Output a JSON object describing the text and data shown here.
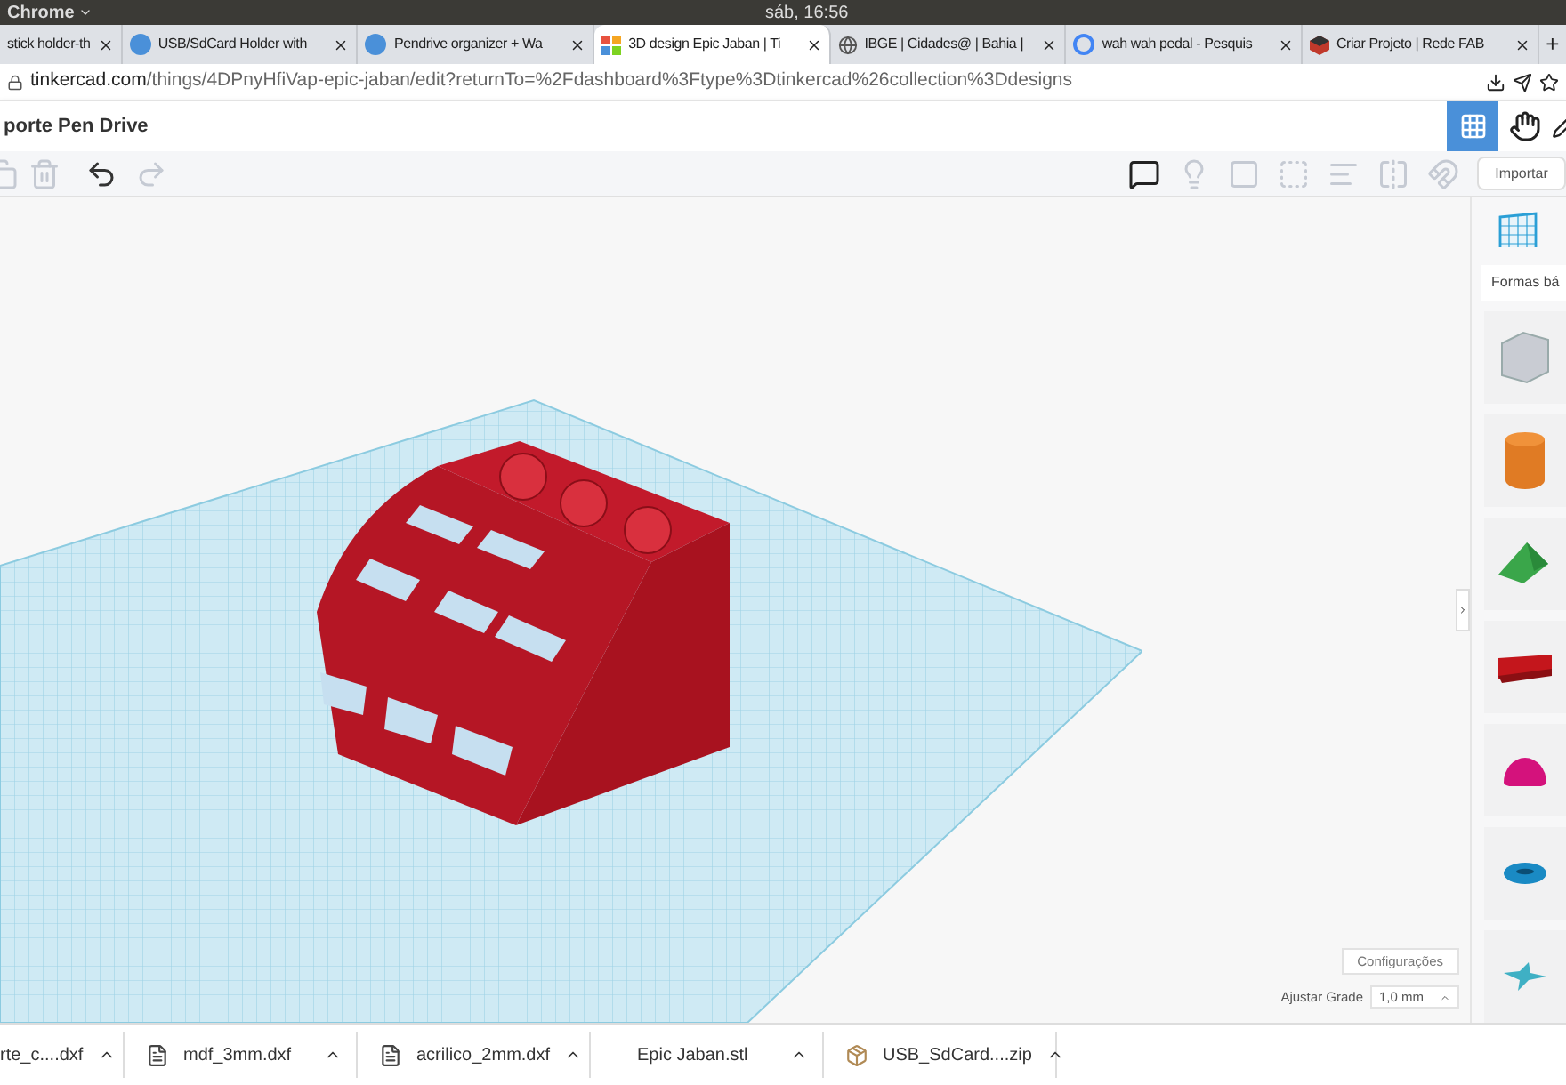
{
  "system_bar": {
    "app": "Chrome",
    "clock": "sáb, 16:56"
  },
  "tabs": [
    {
      "label": "stick holder-th",
      "selected": false
    },
    {
      "label": "USB/SdCard Holder with",
      "selected": false
    },
    {
      "label": "Pendrive organizer + Wa",
      "selected": false
    },
    {
      "label": "3D design Epic Jaban | Ti",
      "selected": true
    },
    {
      "label": "IBGE | Cidades@ | Bahia |",
      "selected": false
    },
    {
      "label": "wah wah pedal - Pesquis",
      "selected": false
    },
    {
      "label": "Criar Projeto | Rede FAB",
      "selected": false
    }
  ],
  "new_tab": "+",
  "url": {
    "host": "tinkercad.com",
    "path": "/things/4DPnyHfiVap-epic-jaban/edit?returnTo=%2Fdashboard%3Ftype%3Dtinkercad%26collection%3Ddesigns"
  },
  "design_title": "porte Pen Drive",
  "import_button": "Importar",
  "shapes_panel": {
    "title": "Formas bá",
    "shapes": [
      {
        "kind": "box"
      },
      {
        "kind": "cylinder"
      },
      {
        "kind": "roof"
      },
      {
        "kind": "text"
      },
      {
        "kind": "half-sphere"
      },
      {
        "kind": "torus"
      },
      {
        "kind": "star"
      }
    ]
  },
  "settings_button": "Configurações",
  "grid": {
    "label": "Ajustar Grade",
    "value": "1,0 mm"
  },
  "downloads": [
    {
      "name": "rte_c....dxf",
      "kind": "none"
    },
    {
      "name": "mdf_3mm.dxf",
      "kind": "file"
    },
    {
      "name": "acrilico_2mm.dxf",
      "kind": "file"
    },
    {
      "name": "Epic Jaban.stl",
      "kind": "none"
    },
    {
      "name": "USB_SdCard....zip",
      "kind": "archive"
    }
  ]
}
